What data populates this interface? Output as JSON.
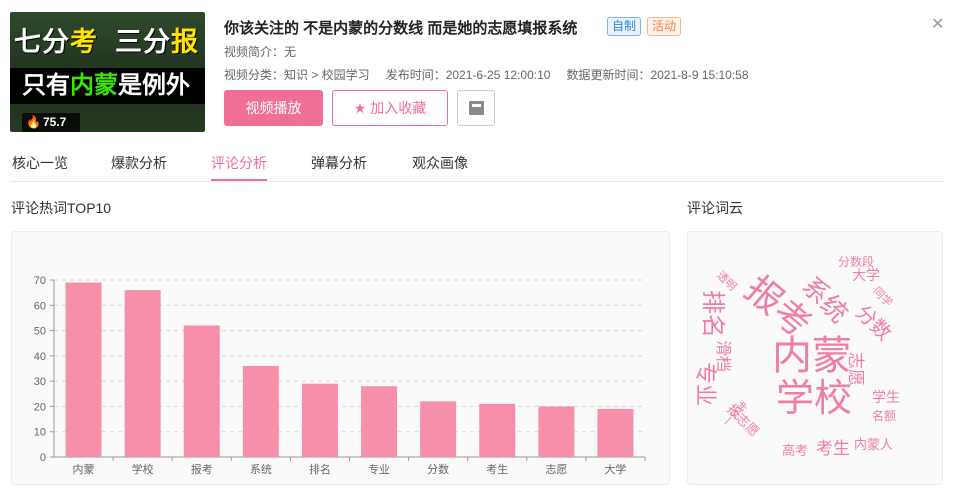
{
  "thumbnail": {
    "line1_white_a": "七分",
    "line1_yellow_a": "考",
    "line1_white_b": "三分",
    "line1_yellow_b": "报",
    "line2_a": "只有",
    "line2_green": "内蒙",
    "line2_b": "是例外",
    "score": "75.7"
  },
  "video": {
    "title": "你该关注的 不是内蒙的分数线 而是她的志愿填报系统",
    "badge_self": "自制",
    "badge_activity": "活动",
    "intro": "视频简介：无",
    "category": "视频分类：知识 > 校园学习",
    "publish_time": "发布时间：2021-6-25 12:00:10",
    "update_time": "数据更新时间：2021-8-9 15:10:58"
  },
  "buttons": {
    "play": "视频播放",
    "favorite": "加入收藏"
  },
  "tabs": [
    "核心一览",
    "爆款分析",
    "评论分析",
    "弹幕分析",
    "观众画像"
  ],
  "sections": {
    "hotwords": "评论热词TOP10",
    "wordcloud": "评论词云"
  },
  "colors": {
    "accent": "#f06f97",
    "bar": "#f78fab",
    "cloud": "#ef7fa0"
  },
  "chart_data": {
    "type": "bar",
    "categories": [
      "内蒙",
      "学校",
      "报考",
      "系统",
      "排名",
      "专业",
      "分数",
      "考生",
      "志愿",
      "大学"
    ],
    "values": [
      69,
      66,
      52,
      36,
      29,
      28,
      22,
      21,
      20,
      19
    ],
    "yticks": [
      0,
      10,
      20,
      30,
      40,
      50,
      60,
      70
    ],
    "ylim": [
      0,
      70
    ],
    "grid": true
  },
  "wordcloud": [
    {
      "text": "内蒙",
      "size": 40
    },
    {
      "text": "学校",
      "size": 38
    },
    {
      "text": "报考",
      "size": 36
    },
    {
      "text": "系统",
      "size": 26
    },
    {
      "text": "排名",
      "size": 24
    },
    {
      "text": "专业",
      "size": 22
    },
    {
      "text": "分数",
      "size": 20
    },
    {
      "text": "考生",
      "size": 17
    },
    {
      "text": "志愿",
      "size": 17
    },
    {
      "text": "大学",
      "size": 14
    },
    {
      "text": "学生",
      "size": 14
    },
    {
      "text": "高考",
      "size": 13
    },
    {
      "text": "名额",
      "size": 12
    },
    {
      "text": "分数段",
      "size": 12
    },
    {
      "text": "同学",
      "size": 11
    },
    {
      "text": "透明",
      "size": 11
    },
    {
      "text": "滑档",
      "size": 16
    },
    {
      "text": "报志愿",
      "size": 13
    },
    {
      "text": "内蒙人",
      "size": 13
    },
    {
      "text": "一分钟",
      "size": 10
    }
  ]
}
